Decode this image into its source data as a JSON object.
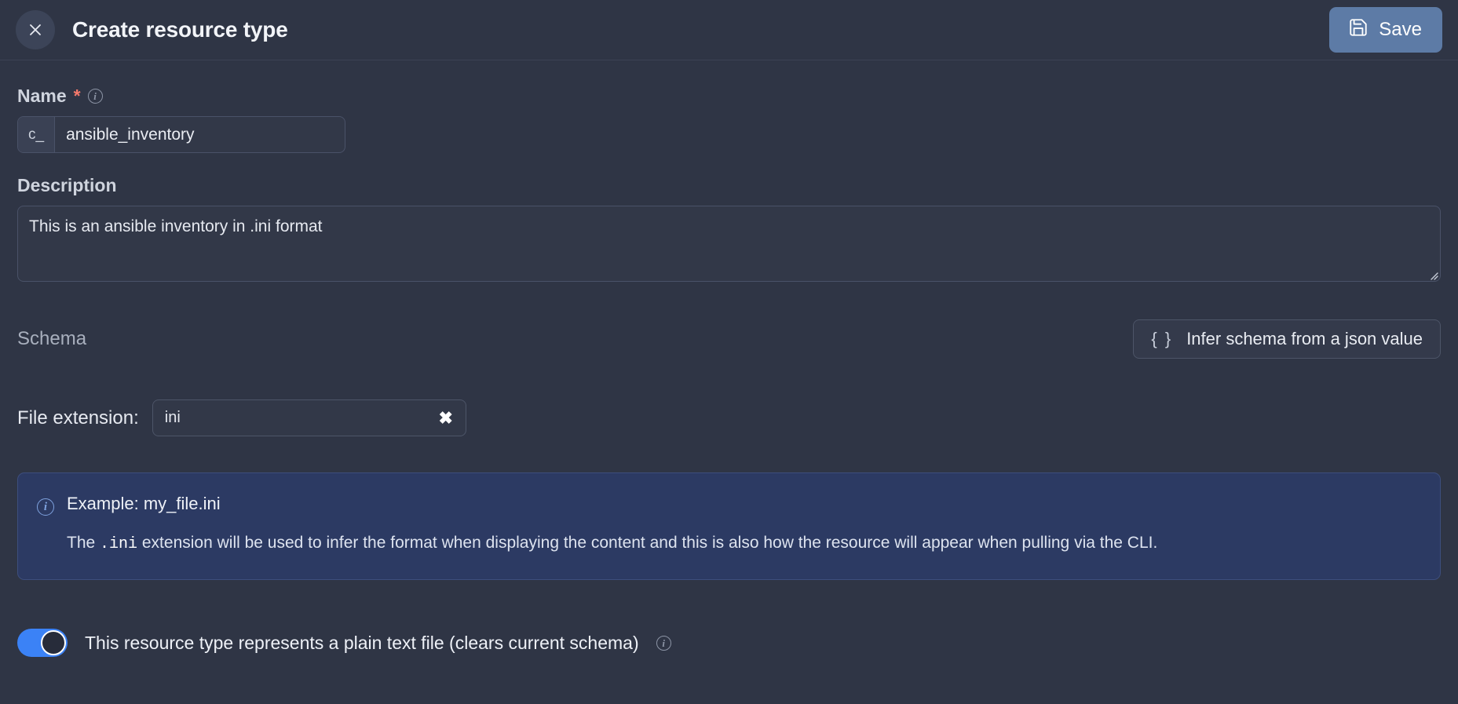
{
  "header": {
    "title": "Create resource type",
    "close_icon": "close-icon",
    "save_label": "Save",
    "save_icon": "save-floppy-icon",
    "save_bg": "#5d7ba6"
  },
  "name_field": {
    "label": "Name",
    "required_marker": "*",
    "info_icon": "info-icon",
    "prefix": "c_",
    "value": "ansible_inventory",
    "placeholder": ""
  },
  "description_field": {
    "label": "Description",
    "value": "This is an ansible inventory in .ini format",
    "placeholder": "",
    "resize_handle": "resize-handle-icon"
  },
  "schema_section": {
    "title": "Schema",
    "infer_button_label": "Infer schema from a json value",
    "infer_button_icon": "curly-braces-icon",
    "braces": "{ }"
  },
  "file_extension": {
    "label": "File extension:",
    "value": "ini",
    "placeholder": "",
    "clear_icon": "clear-x-icon",
    "clear_glyph": "✖"
  },
  "callout": {
    "icon": "info-icon",
    "accent": "#2c3a63",
    "title": "Example: my_file.ini",
    "text_before": "The ",
    "code": ".ini",
    "text_after": " extension will be used to infer the format when displaying the content and this is also how the resource will appear when pulling via the CLI."
  },
  "plain_text_toggle": {
    "state": "on",
    "accent": "#3b82f6",
    "label": "This resource type represents a plain text file (clears current schema)",
    "info_icon": "info-icon"
  }
}
